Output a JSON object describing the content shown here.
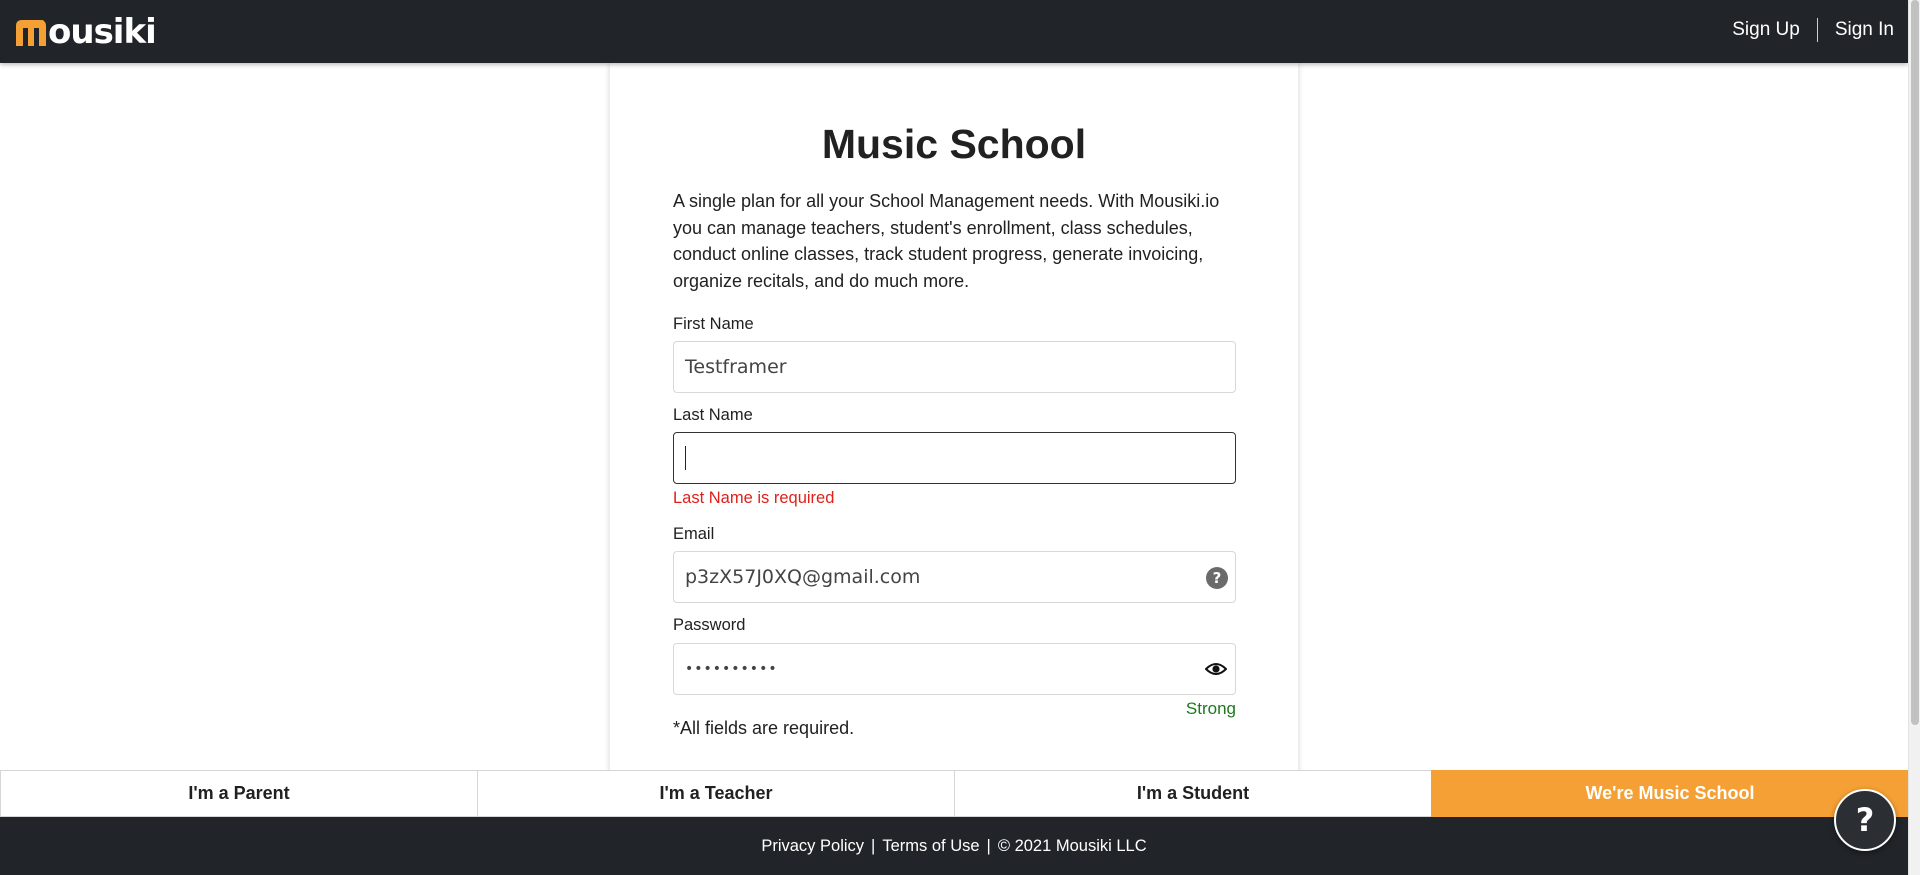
{
  "header": {
    "logo_text": "ousiki",
    "nav": {
      "sign_up": "Sign Up",
      "sign_in": "Sign In"
    }
  },
  "form": {
    "title": "Music School",
    "intro": "A single plan for all your School Management needs. With Mousiki.io you can manage teachers, student's enrollment, class schedules, conduct online classes, track student progress, generate invoicing, organize recitals, and do much more.",
    "first_name": {
      "label": "First Name",
      "value": "Testframer"
    },
    "last_name": {
      "label": "Last Name",
      "value": "",
      "error": "Last Name is required"
    },
    "email": {
      "label": "Email",
      "value": "p3zX57J0XQ@gmail.com",
      "help_glyph": "?"
    },
    "password": {
      "label": "Password",
      "value": "••••••••••",
      "strength": "Strong"
    },
    "required_note": "*All fields are required."
  },
  "role_tabs": [
    {
      "label": "I'm a Parent",
      "active": false
    },
    {
      "label": "I'm a Teacher",
      "active": false
    },
    {
      "label": "I'm a Student",
      "active": false
    },
    {
      "label": "We're Music School",
      "active": true
    }
  ],
  "footer": {
    "privacy": "Privacy Policy",
    "terms": "Terms of Use",
    "copyright": "© 2021 Mousiki LLC",
    "separator": "|"
  },
  "floating_help": {
    "glyph": "?"
  },
  "colors": {
    "brand_orange": "#f5a034",
    "header_bg": "#212529",
    "error_red": "#e0201a",
    "strength_green": "#1b7a1b"
  },
  "icons": [
    "mousiki-logo-icon",
    "help-icon",
    "eye-icon",
    "floating-help-icon"
  ]
}
